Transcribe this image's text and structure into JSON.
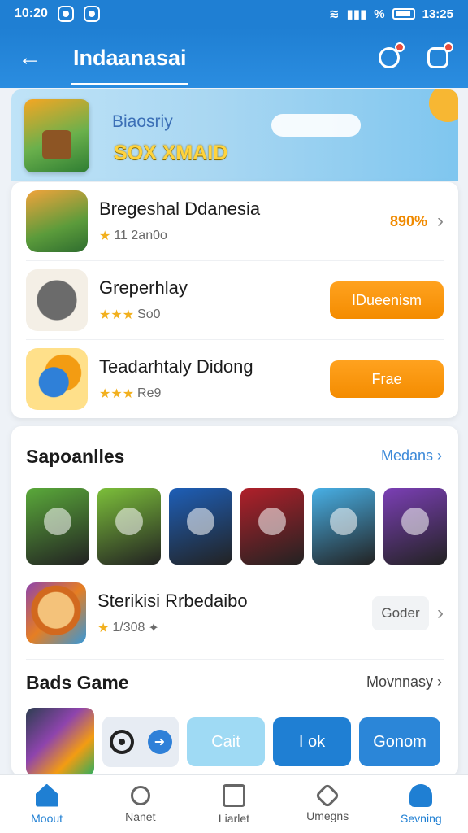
{
  "status": {
    "time": "10:20",
    "battery_pct": "%",
    "clock_right": "13:25"
  },
  "app_bar": {
    "title": "Indaanasai"
  },
  "banner": {
    "title": "Biaosriy",
    "tagline": "SOX XMAID"
  },
  "featured": [
    {
      "title": "Bregeshal Ddanesia",
      "rating": "11 2an0o",
      "badge": "890%"
    },
    {
      "title": "Greperhlay",
      "rating": "So0",
      "action": "IDueenism"
    },
    {
      "title": "Teadarhtaly Didong",
      "rating": "Re9",
      "action": "Frae"
    }
  ],
  "section1": {
    "title": "Sapoanlles",
    "more": "Medans",
    "tile_colors": [
      "#5aa93a",
      "#7cbf3a",
      "#1e5fb8",
      "#b0202a",
      "#48b0e6",
      "#7b3fb5"
    ],
    "game": {
      "title": "Sterikisi Rrbedaibo",
      "rating": "1/308",
      "button": "Goder"
    }
  },
  "section2": {
    "title": "Bads Game",
    "more": "Movnnasy",
    "chips": [
      "Cait",
      "I ok",
      "Gonom"
    ]
  },
  "nav": [
    "Moout",
    "Nanet",
    "Liarlet",
    "Umegns",
    "Sevning"
  ]
}
